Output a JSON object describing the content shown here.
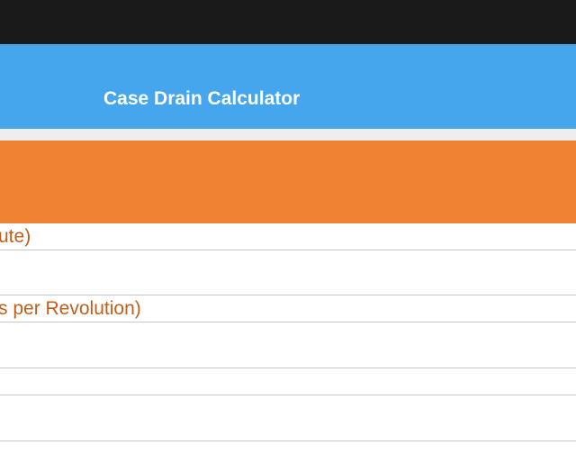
{
  "app": {
    "title": "Case Drain Calculator"
  },
  "colors": {
    "status_bar": "#1a1a1a",
    "nav_bar": "#45a6ee",
    "section_header": "#f08233",
    "label_text": "#c05f1b",
    "divider": "#c8c8c8"
  },
  "form": {
    "fields": [
      {
        "label": "ute)",
        "value": ""
      },
      {
        "label": "s per Revolution)",
        "value": ""
      }
    ],
    "extra_rows": [
      {
        "value": ""
      },
      {
        "value": ""
      }
    ]
  }
}
